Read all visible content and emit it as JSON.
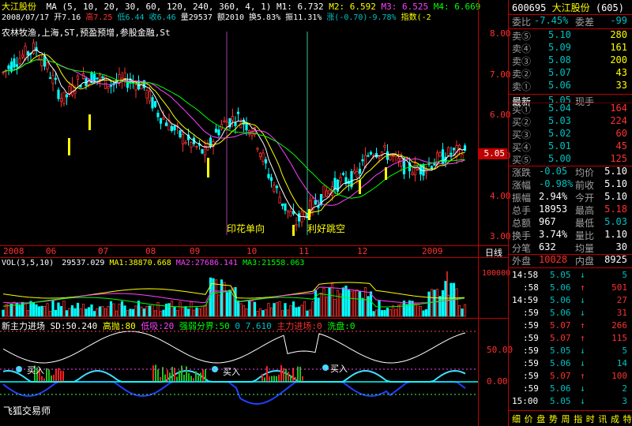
{
  "stock": {
    "name": "大江股份",
    "code": "600695",
    "ma_params": "MA (5, 10, 20, 30, 60, 120, 240, 360, 4, 1)",
    "m1": "M1: 6.732",
    "m2": "M2: 6.592",
    "m3": "M3: 6.525",
    "m4": "M4: 6.669",
    "date": "2008/07/17",
    "open": "开7.16",
    "high": "高7.25",
    "low": "低6.44",
    "close": "收6.46",
    "volume": "量29537",
    "amount": "额2010",
    "turnover": "换5.83%",
    "amplitude": "振11.31%",
    "change": "涨(-0.70)-9.78%",
    "index_label": "指数(-2",
    "concepts": "农林牧渔,上海,ST,预盈预增,参股金融,St",
    "annotation_line": "17",
    "price_tag": "5.05"
  },
  "price_axis": [
    "8.00",
    "7.00",
    "6.00",
    "5.00",
    "4.00",
    "3.00"
  ],
  "date_axis": [
    "2008",
    "06",
    "07",
    "08",
    "09",
    "10",
    "11",
    "12",
    "2009"
  ],
  "period_label": "日线",
  "events": [
    "印花单向",
    "利好跳空"
  ],
  "volume_panel": {
    "label": "VOL(3,5,10)",
    "value": "29537.029",
    "ma1": "MA1:38870.668",
    "ma2": "MA2:27686.141",
    "ma3": "MA3:21558.063",
    "axis": [
      "100000",
      "50000"
    ]
  },
  "indicator_panel": {
    "title": "新主力进场",
    "sd": "SD:50.240",
    "high_sell": "高抛:80",
    "low_buy": "低吸:20",
    "strong_weak": "强弱分界:50",
    "zero_a": "0",
    "val7": "7.610",
    "main_entry": "主力进场:0",
    "wash": "洗盘:0",
    "axis": [
      "50.00",
      "0.00"
    ],
    "buy_label": "买入"
  },
  "footer": "飞狐交易师",
  "quote": {
    "code": "600695",
    "name": "大江股份",
    "suffix": "(605)",
    "weibi_label": "委比",
    "weibi_value": "-7.45%",
    "weicha_label": "委差",
    "weicha_value": "-99",
    "asks": [
      {
        "label": "卖⑤",
        "price": "5.10",
        "vol": "280"
      },
      {
        "label": "卖④",
        "price": "5.09",
        "vol": "161"
      },
      {
        "label": "卖③",
        "price": "5.08",
        "vol": "200"
      },
      {
        "label": "卖②",
        "price": "5.07",
        "vol": "43"
      },
      {
        "label": "卖①",
        "price": "5.06",
        "vol": "33"
      }
    ],
    "last_label": "最新",
    "last_price": "5.05",
    "last_extra": "现手",
    "bids": [
      {
        "label": "买①",
        "price": "5.04",
        "vol": "164"
      },
      {
        "label": "买②",
        "price": "5.03",
        "vol": "224"
      },
      {
        "label": "买③",
        "price": "5.02",
        "vol": "60"
      },
      {
        "label": "买④",
        "price": "5.01",
        "vol": "45"
      },
      {
        "label": "买⑤",
        "price": "5.00",
        "vol": "125"
      }
    ],
    "stats": [
      {
        "l1": "涨跌",
        "v1": "-0.05",
        "l2": "均价",
        "v2": "5.10"
      },
      {
        "l1": "涨幅",
        "v1": "-0.98%",
        "l2": "前收",
        "v2": "5.10"
      },
      {
        "l1": "振幅",
        "v1": "2.94%",
        "l2": "今开",
        "v2": "5.10"
      },
      {
        "l1": "总手",
        "v1": "18953",
        "l2": "最高",
        "v2": "5.18"
      },
      {
        "l1": "总额",
        "v1": "967",
        "l2": "最低",
        "v2": "5.03"
      },
      {
        "l1": "换手",
        "v1": "3.74%",
        "l2": "量比",
        "v2": "1.10"
      },
      {
        "l1": "分笔",
        "v1": "632",
        "l2": "均量",
        "v2": "30"
      }
    ],
    "outer_label": "外盘",
    "outer_value": "10028",
    "inner_label": "内盘",
    "inner_value": "8925",
    "ticks": [
      {
        "time": "14:58",
        "price": "5.05",
        "dir": "↓",
        "vol": "5"
      },
      {
        "time": ":58",
        "price": "5.06",
        "dir": "↑",
        "vol": "501"
      },
      {
        "time": "14:59",
        "price": "5.06",
        "dir": "↓",
        "vol": "27"
      },
      {
        "time": ":59",
        "price": "5.06",
        "dir": "↓",
        "vol": "31"
      },
      {
        "time": ":59",
        "price": "5.07",
        "dir": "↑",
        "vol": "266"
      },
      {
        "time": ":59",
        "price": "5.07",
        "dir": "↑",
        "vol": "115"
      },
      {
        "time": ":59",
        "price": "5.05",
        "dir": "↓",
        "vol": "5"
      },
      {
        "time": ":59",
        "price": "5.06",
        "dir": "↓",
        "vol": "14"
      },
      {
        "time": ":59",
        "price": "5.07",
        "dir": "↑",
        "vol": "100"
      },
      {
        "time": ":59",
        "price": "5.06",
        "dir": "↓",
        "vol": "2"
      },
      {
        "time": "15:00",
        "price": "5.05",
        "dir": "↓",
        "vol": "3"
      }
    ],
    "bottom_tabs": "细 价 盘 势 周 指 时 讯 成 特 解"
  },
  "colors": {
    "up": "#ff3030",
    "down": "#00ffff",
    "axis": "#c00000",
    "text_yellow": "#ffff00"
  }
}
